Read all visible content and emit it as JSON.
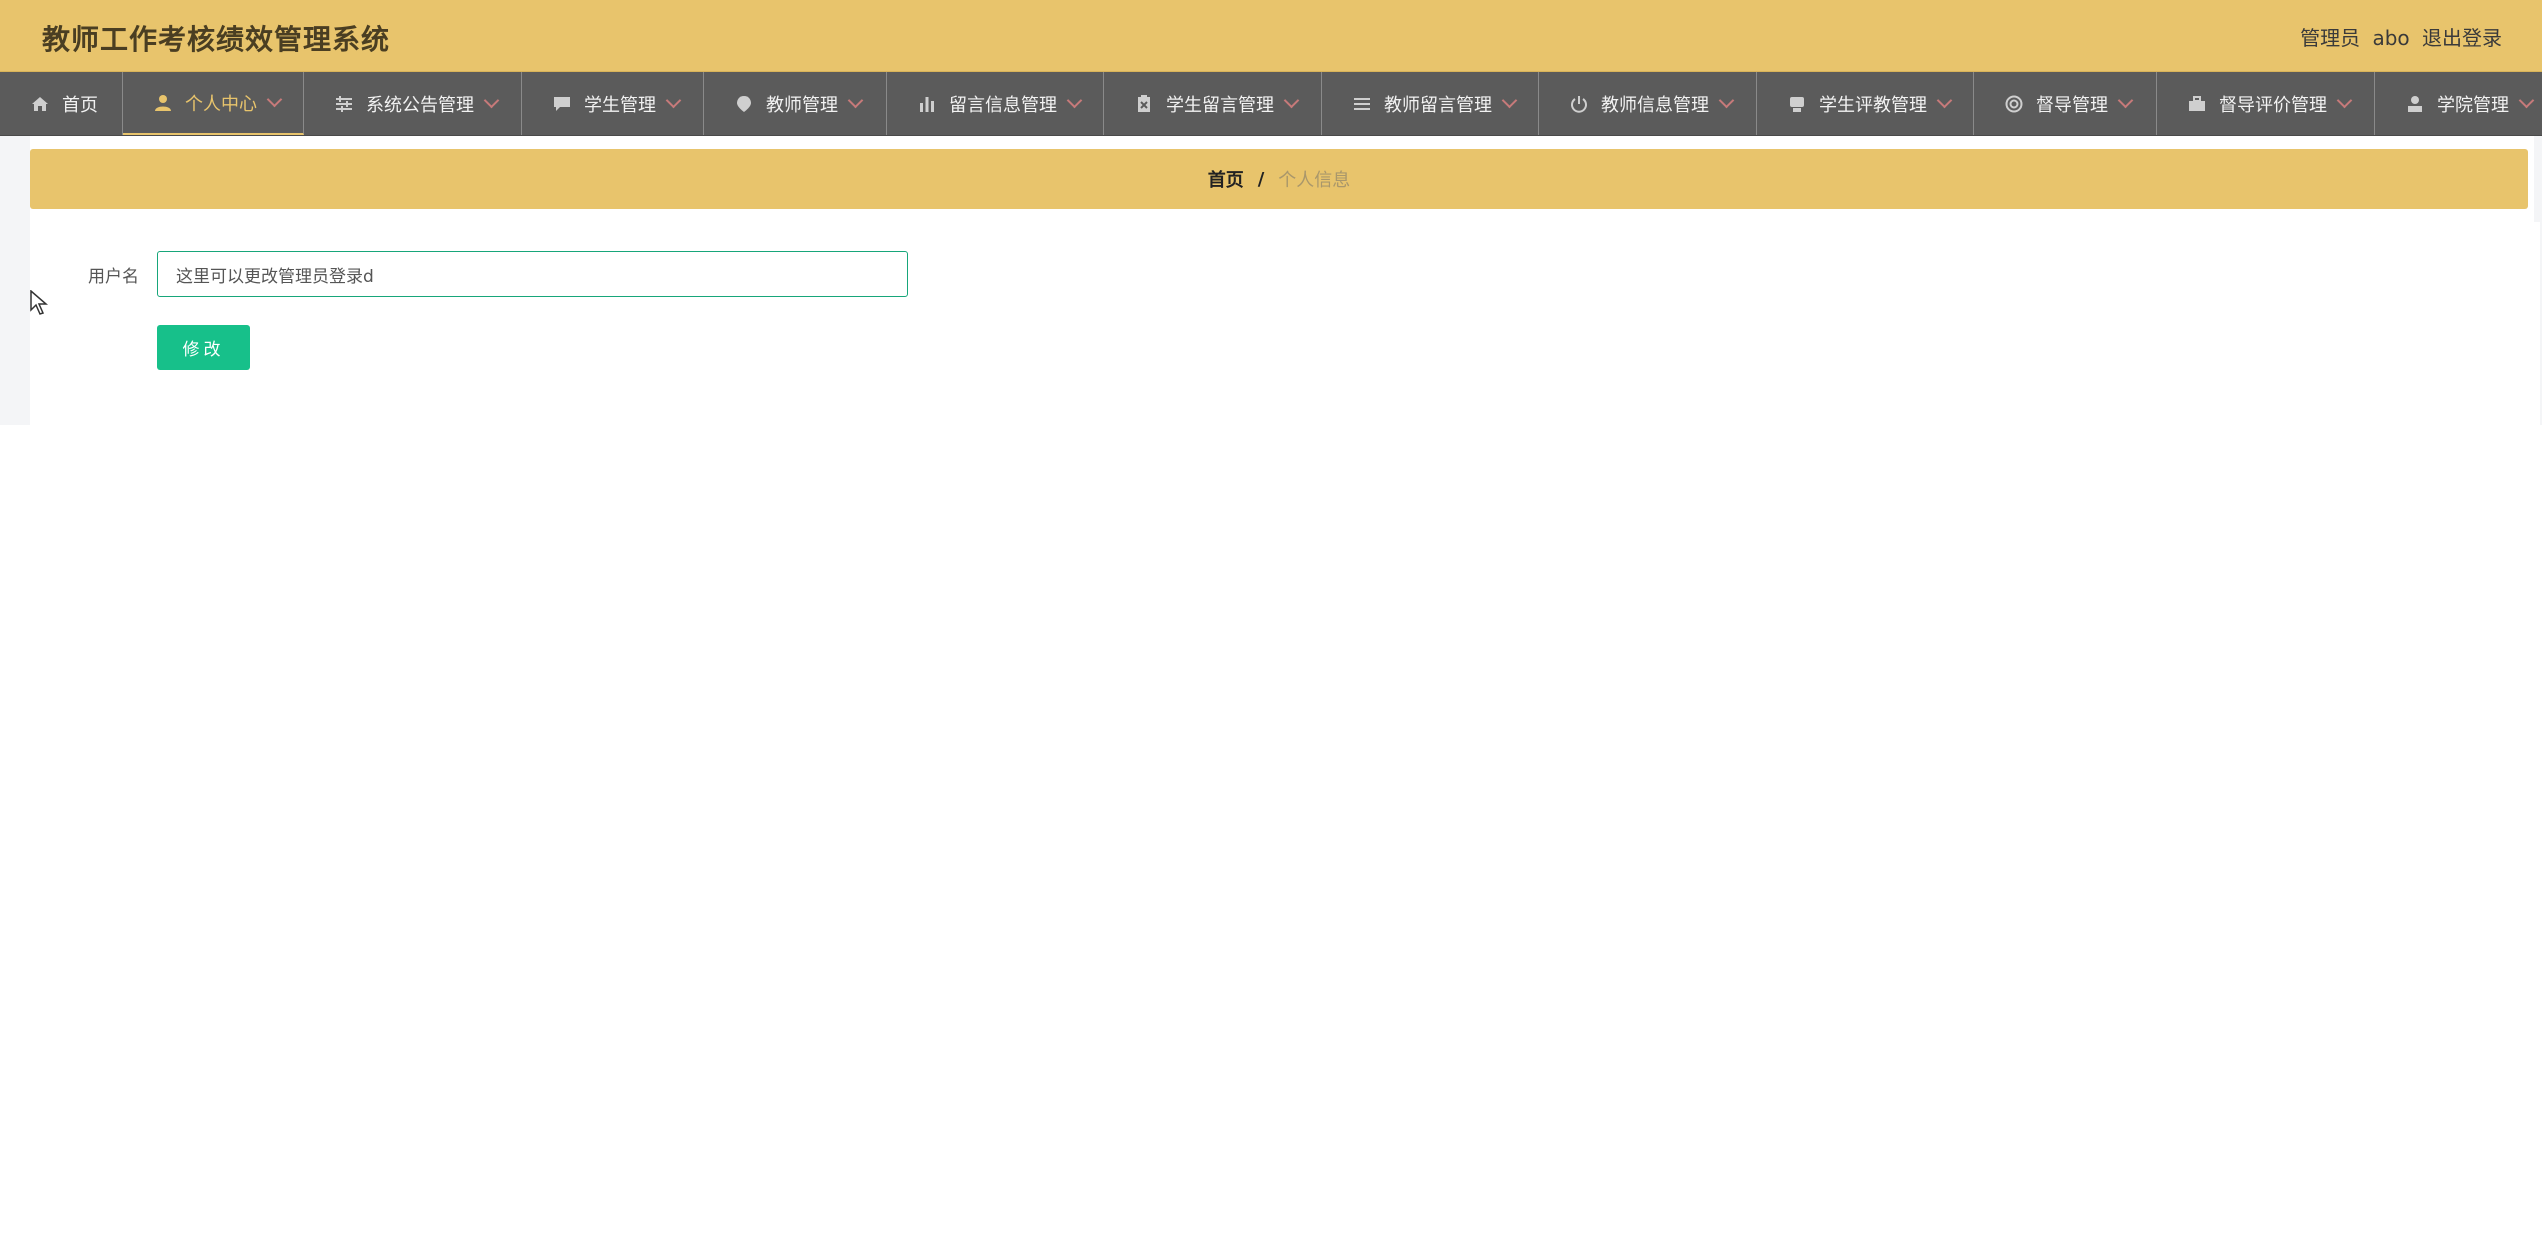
{
  "header": {
    "title": "教师工作考核绩效管理系统",
    "role": "管理员",
    "username": "abo",
    "logout_label": "退出登录"
  },
  "nav": [
    {
      "label": "首页",
      "icon": "home-icon",
      "active": false
    },
    {
      "label": "个人中心",
      "icon": "user-icon",
      "active": true
    },
    {
      "label": "系统公告管理",
      "icon": "sliders-icon",
      "active": false
    },
    {
      "label": "学生管理",
      "icon": "chat-icon",
      "active": false
    },
    {
      "label": "教师管理",
      "icon": "location-pin-icon",
      "active": false
    },
    {
      "label": "留言信息管理",
      "icon": "bar-chart-icon",
      "active": false
    },
    {
      "label": "学生留言管理",
      "icon": "clipboard-icon",
      "active": false
    },
    {
      "label": "教师留言管理",
      "icon": "list-icon",
      "active": false
    },
    {
      "label": "教师信息管理",
      "icon": "power-icon",
      "active": false
    },
    {
      "label": "学生评教管理",
      "icon": "printer-icon",
      "active": false
    },
    {
      "label": "督导管理",
      "icon": "lifebuoy-icon",
      "active": false
    },
    {
      "label": "督导评价管理",
      "icon": "briefcase-icon",
      "active": false
    },
    {
      "label": "学院管理",
      "icon": "person-icon",
      "active": false
    }
  ],
  "breadcrumb": {
    "home": "首页",
    "separator": "/",
    "current": "个人信息"
  },
  "form": {
    "username_label": "用户名",
    "username_value": "这里可以更改管理员登录d",
    "submit_label": "修改"
  },
  "colors": {
    "header_bg": "#e8c46c",
    "nav_bg": "#5b5b5b",
    "accent": "#17c08a",
    "input_border": "#17a67a"
  }
}
